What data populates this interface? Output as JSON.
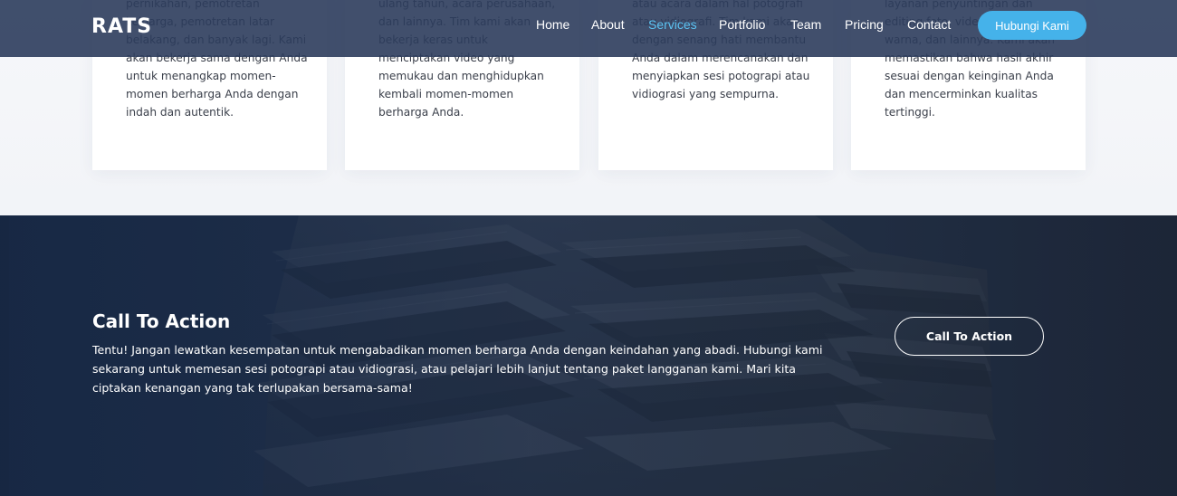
{
  "header": {
    "logo": "RATS",
    "nav": {
      "home": "Home",
      "about": "About",
      "services": "Services",
      "portfolio": "Portfolio",
      "team": "Team",
      "pricing": "Pricing",
      "contact": "Contact"
    },
    "active_item": "Services",
    "cta_label": "Hubungi Kami"
  },
  "services": {
    "cards": [
      {
        "text": "pernikahan, pemotretan keluarga, pemotretan latar belakang, dan banyak lagi. Kami akan bekerja sama dengan Anda untuk menangkap momen-momen berharga Anda dengan indah dan autentik."
      },
      {
        "text": "ulang tahun, acara perusahaan, dan lainnya. Tim kami akan bekerja keras untuk menciptakan video yang memukau dan menghidupkan kembali momen-momen berharga Anda."
      },
      {
        "text": "atau acara dalam hal potografi atau vidiografi. Tim kami akan dengan senang hati membantu Anda dalam merencanakan dan menyiapkan sesi potograpi atau vidiograsi yang sempurna."
      },
      {
        "text": "layanan penyuntingan dan editing foto, video pernikahan, warna, dan lainnya. Kami akan memastikan bahwa hasil akhir sesuai dengan keinginan Anda dan mencerminkan kualitas tertinggi."
      }
    ]
  },
  "cta": {
    "title": "Call To Action",
    "description": "Tentu! Jangan lewatkan kesempatan untuk mengabadikan momen berharga Anda dengan keindahan yang abadi. Hubungi kami sekarang untuk memesan sesi potograpi atau vidiograsi, atau pelajari lebih lanjut tentang paket langganan kami. Mari kita ciptakan kenangan yang tak terlupakan bersama-sama!",
    "button_label": "Call To Action"
  },
  "colors": {
    "header_bg": "#2c3c5c",
    "accent": "#45b2ea",
    "active_nav": "#5cc3f2",
    "cta_bg": "#1f2a3a"
  }
}
